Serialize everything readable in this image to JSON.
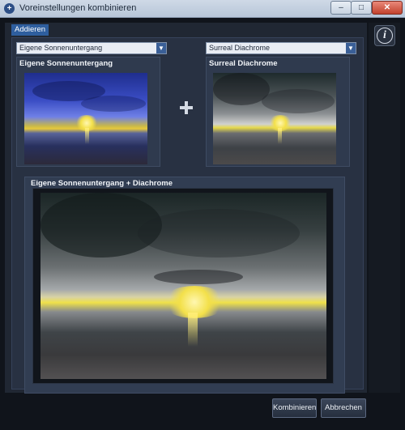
{
  "window": {
    "title": "Voreinstellungen kombinieren",
    "minimize_label": "–",
    "maximize_label": "□",
    "close_label": "✕"
  },
  "tab": {
    "label": "Addieren"
  },
  "info_button": {
    "label": "i"
  },
  "preset1": {
    "select_value": "Eigene Sonnenuntergang",
    "title": "Eigene Sonnenuntergang"
  },
  "preset2": {
    "select_value": "Surreal Diachrome",
    "title": "Surreal Diachrome"
  },
  "result": {
    "title": "Eigene Sonnenuntergang + Diachrome"
  },
  "buttons": {
    "combine": "Kombinieren",
    "cancel": "Abbrechen"
  },
  "icons": {
    "plus": "plus-icon",
    "dropdown": "chevron-down-icon",
    "info": "info-icon"
  }
}
